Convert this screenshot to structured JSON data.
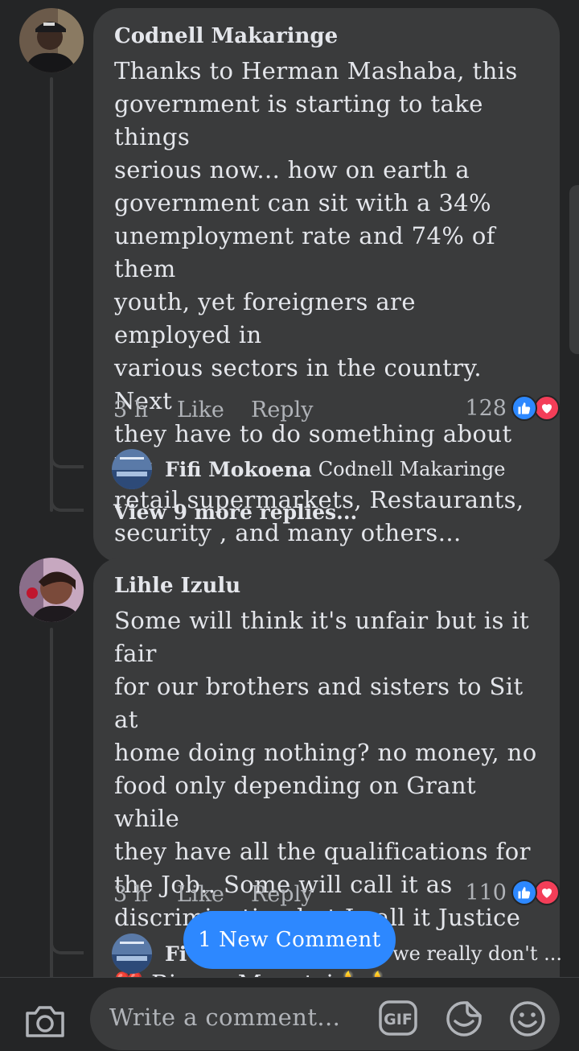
{
  "comments": [
    {
      "author": "Codnell Makaringe",
      "lines": [
        "Thanks to Herman Mashaba, this",
        "government is starting to take things",
        "serious now... how on earth a",
        "government can sit with a 34%",
        "unemployment rate and 74% of them",
        "youth, yet foreigners are employed in",
        "various sectors in the country. Next",
        "they have to do something about big",
        "retail supermarkets, Restaurants,",
        "security , and many others..."
      ],
      "time": "3 h",
      "like_label": "Like",
      "reply_label": "Reply",
      "reaction_count": "128",
      "reply_preview": {
        "name": "Fifi Mokoena",
        "text": "Codnell Makaringe"
      },
      "view_more": "View 9 more replies..."
    },
    {
      "author": "Lihle Izulu",
      "lines": [
        "Some will think it's unfair but is it fair",
        "for our brothers and sisters to Sit at",
        "home doing nothing? no money, no",
        "food only depending on Grant while",
        "they have all the qualifications for",
        "the  Job.. Some will call it as",
        "discrimination but I call it  Justice ❤️",
        "❤️ Big up Mzantsi🕯️🕯️"
      ],
      "time": "3 h",
      "like_label": "Like",
      "reply_label": "Reply",
      "reaction_count": "110",
      "reply_preview": {
        "name": "Fi",
        "text": "d we really don't ..."
      }
    }
  ],
  "new_comment_pill": "1 New Comment",
  "composer": {
    "placeholder": "Write a comment...",
    "gif_label": "GIF"
  },
  "colors": {
    "background": "#242526",
    "bubble": "#3a3b3c",
    "accent": "#2d88ff",
    "love": "#f33e58"
  }
}
